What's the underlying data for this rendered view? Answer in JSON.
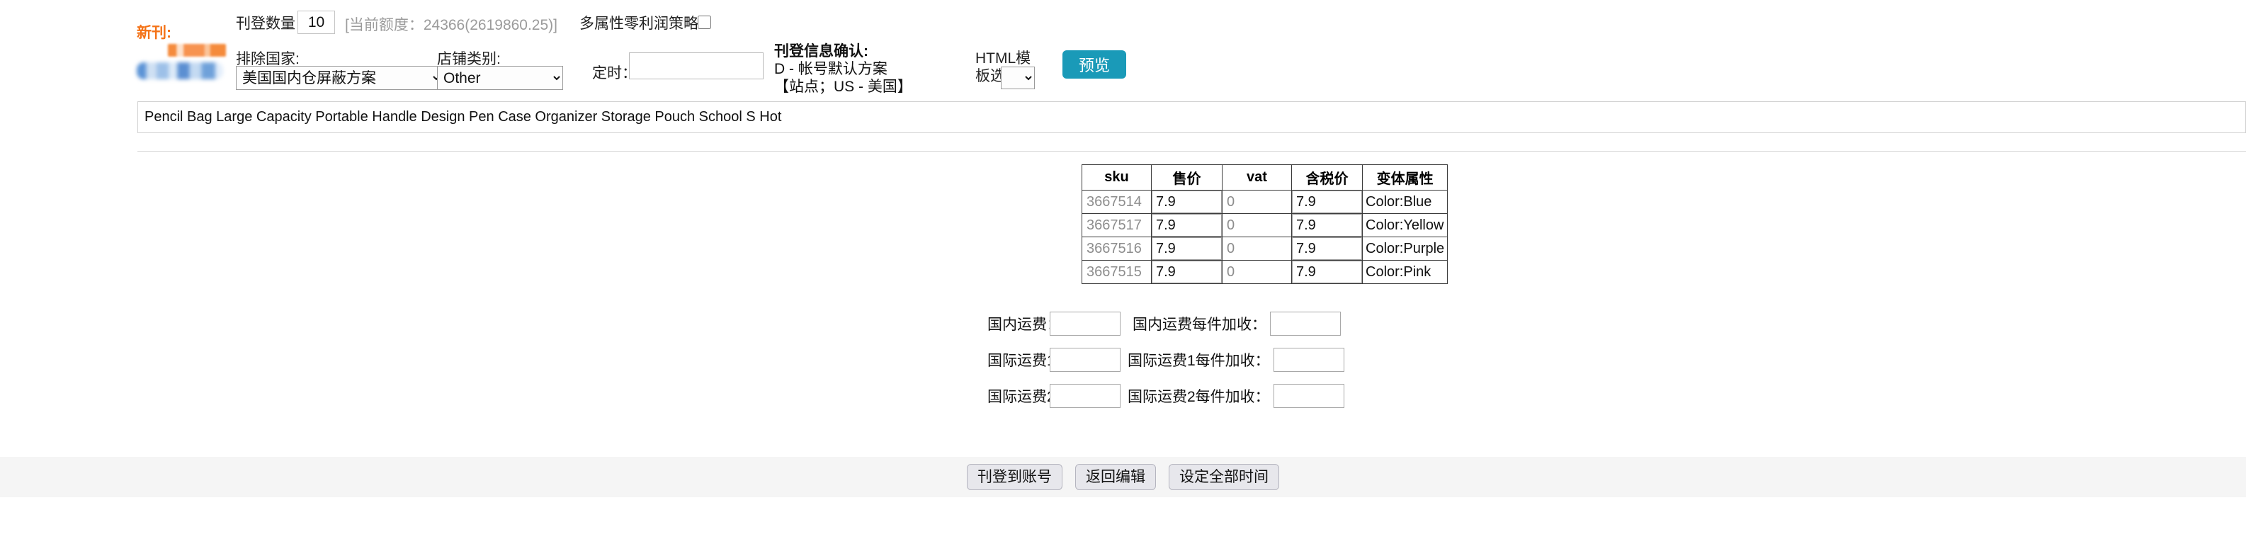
{
  "top_form": {
    "new_publish_label": "新刊:",
    "qty_label": "刊登数量：",
    "qty_value": "10",
    "quota_text": "[当前额度：24366(2619860.25)]",
    "multi_attr_label": "多属性零利润策略",
    "exclude_country_label": "排除国家:",
    "exclude_country_value": "美国国内仓屏蔽方案",
    "shop_type_label": "店铺类别:",
    "shop_type_value": "Other",
    "schedule_label": "定时：",
    "schedule_value": "",
    "confirm_title": "刊登信息确认:",
    "confirm_line1": "D - 帐号默认方案",
    "confirm_line2": "【站点；US - 美国】",
    "html_template_label": "HTML模板选择:",
    "html_template_value": "",
    "preview_button": "预览"
  },
  "title_row": {
    "value": "Pencil Bag Large Capacity Portable Handle Design Pen Case Organizer Storage Pouch School S Hot"
  },
  "sku_table": {
    "headers": [
      "sku",
      "售价",
      "vat",
      "含税价",
      "变体属性"
    ],
    "rows": [
      {
        "sku": "3667514",
        "price": "7.9",
        "vat": "0",
        "tax_price": "7.9",
        "attr": "Color:Blue"
      },
      {
        "sku": "3667517",
        "price": "7.9",
        "vat": "0",
        "tax_price": "7.9",
        "attr": "Color:Yellow"
      },
      {
        "sku": "3667516",
        "price": "7.9",
        "vat": "0",
        "tax_price": "7.9",
        "attr": "Color:Purple"
      },
      {
        "sku": "3667515",
        "price": "7.9",
        "vat": "0",
        "tax_price": "7.9",
        "attr": "Color:Pink"
      }
    ]
  },
  "shipping": {
    "rows": [
      {
        "a_label": "国内运费：",
        "a_value": "",
        "b_label": "国内运费每件加收：",
        "b_value": ""
      },
      {
        "a_label": "国际运费1：",
        "a_value": "",
        "b_label": "国际运费1每件加收：",
        "b_value": ""
      },
      {
        "a_label": "国际运费2：",
        "a_value": "",
        "b_label": "国际运费2每件加收：",
        "b_value": ""
      }
    ]
  },
  "footer": {
    "buttons": [
      "刊登到账号",
      "返回编辑",
      "设定全部时间"
    ]
  },
  "colors": {
    "accent_orange": "#f47216",
    "preview_teal": "#1a9ab8",
    "footer_bg": "#f5f5f5",
    "muted_text": "#9b9b9b"
  }
}
